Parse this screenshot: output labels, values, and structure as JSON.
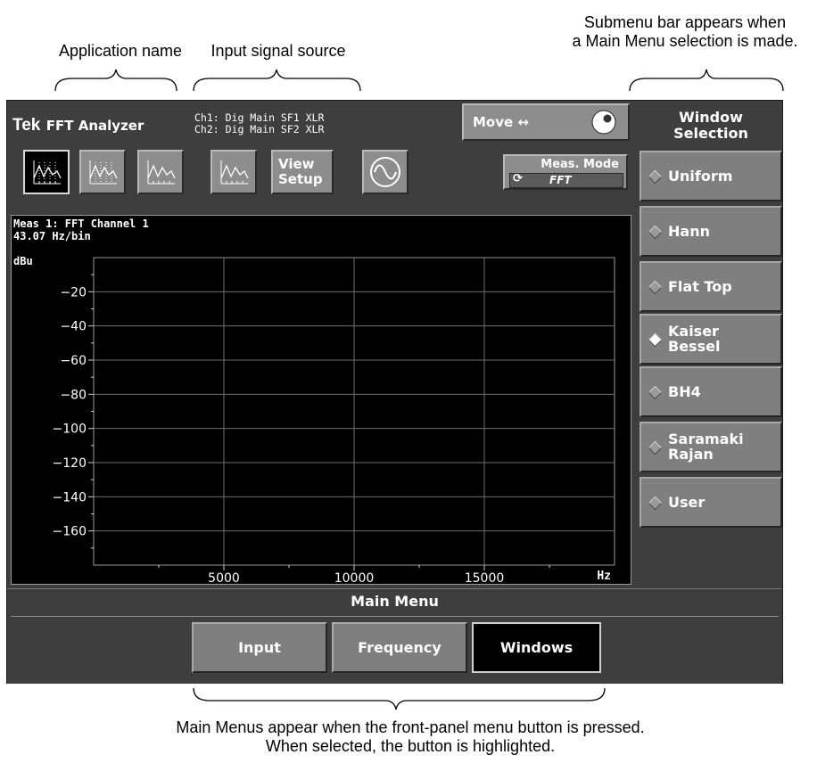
{
  "annotations": {
    "app_name": "Application name",
    "input_source": "Input signal source",
    "submenu_line1": "Submenu bar appears when",
    "submenu_line2": "a Main Menu selection is made.",
    "main_line1": "Main Menus appear when the front-panel menu button is pressed.",
    "main_line2": "When selected, the button is highlighted."
  },
  "header": {
    "brand": "Tek",
    "app": "FFT Analyzer",
    "ch1": "Ch1: Dig Main SF1 XLR",
    "ch2": "Ch2: Dig Main SF2 XLR",
    "move_label": "Move ↔"
  },
  "toolbar": {
    "view_setup_line1": "View",
    "view_setup_line2": "Setup",
    "meas_mode_label": "Meas. Mode",
    "meas_mode_value": "FFT"
  },
  "plot": {
    "title": "Meas 1: FFT Channel 1",
    "resolution": "43.07 Hz/bin",
    "y_unit": "dBu",
    "x_unit": "Hz"
  },
  "chart_data": {
    "type": "line",
    "title": "Meas 1: FFT Channel 1",
    "xlabel": "Hz",
    "ylabel": "dBu",
    "xlim": [
      0,
      20000
    ],
    "ylim": [
      -180,
      0
    ],
    "x_ticks": [
      "5000",
      "10000",
      "15000"
    ],
    "y_ticks": [
      "-20",
      "-40",
      "-60",
      "-80",
      "-100",
      "-120",
      "-140",
      "-160"
    ],
    "grid": true,
    "series": []
  },
  "submenu": {
    "title_line1": "Window",
    "title_line2": "Selection",
    "items": [
      {
        "line1": "Uniform",
        "line2": "",
        "selected": false
      },
      {
        "line1": "Hann",
        "line2": "",
        "selected": false
      },
      {
        "line1": "Flat Top",
        "line2": "",
        "selected": false
      },
      {
        "line1": "Kaiser",
        "line2": "Bessel",
        "selected": true
      },
      {
        "line1": "BH4",
        "line2": "",
        "selected": false
      },
      {
        "line1": "Saramaki",
        "line2": "Rajan",
        "selected": false
      },
      {
        "line1": "User",
        "line2": "",
        "selected": false
      }
    ]
  },
  "main_menu": {
    "title": "Main Menu",
    "buttons": [
      "Input",
      "Frequency",
      "Windows"
    ],
    "selected": "Windows"
  },
  "colors": {
    "panel": "#3e3e3e",
    "button": "#7f7f7f",
    "selected_button": "#000000",
    "plot_bg": "#000000",
    "text": "#ffffff"
  }
}
